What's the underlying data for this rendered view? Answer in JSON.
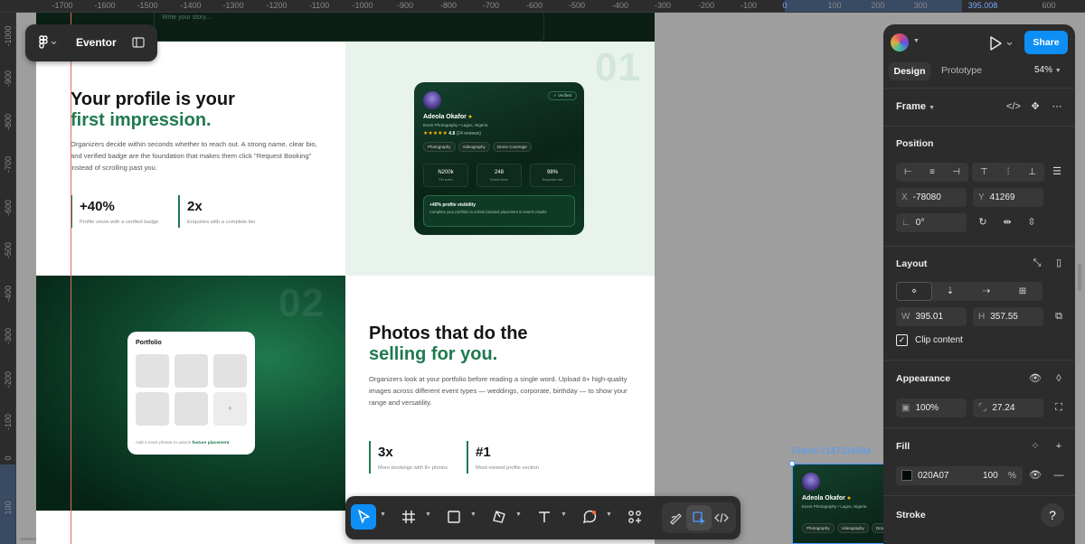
{
  "ruler": {
    "top_ticks": [
      "-1700",
      "-1600",
      "-1500",
      "-1400",
      "-1300",
      "-1200",
      "-1100",
      "-1000",
      "-900",
      "-800",
      "-700",
      "-600",
      "-500",
      "-400",
      "-300",
      "-200",
      "-100",
      "0",
      "100",
      "200",
      "300",
      "395.008",
      "600"
    ],
    "left_ticks": [
      "-1000",
      "-900",
      "-800",
      "-700",
      "-600",
      "-500",
      "-400",
      "-300",
      "-200",
      "-100",
      "0",
      "100"
    ]
  },
  "file": {
    "name": "Eventor"
  },
  "canvas": {
    "story_placeholder": "Write your story...",
    "section1": {
      "title_line1": "Your profile is your",
      "title_line2": "first impression.",
      "body": "Organizers decide within seconds whether to reach out. A strong name, clear bio, and verified badge are the foundation that makes them click \"Request Booking\" instead of scrolling past you.",
      "stats": [
        {
          "value": "+40%",
          "label": "Profile views with a verified badge"
        },
        {
          "value": "2x",
          "label": "Enquiries with a complete bio"
        }
      ],
      "number": "01"
    },
    "profile_card": {
      "verified": "✓ Verified",
      "name": "Adeola Okafor",
      "subtitle": "Event Photography  •  Lagos, Nigeria",
      "stars": "★★★★★",
      "rating": "4.8",
      "reviews": "(24 reviews)",
      "tags": [
        "Photography",
        "Videography",
        "Drone Coverage"
      ],
      "metrics": [
        {
          "value": "N200k",
          "label": "Per event"
        },
        {
          "value": "248",
          "label": "Events done"
        },
        {
          "value": "98%",
          "label": "Response rate"
        }
      ],
      "boost_title": "+40% profile visibility",
      "boost_text": "Complete your portfolio to unlock boosted placement in search results"
    },
    "section2": {
      "number": "02",
      "title_line1": "Photos that do the",
      "title_line2": "selling for you.",
      "body": "Organizers look at your portfolio before reading a single word. Upload 8+ high-quality images across different event types — weddings, corporate, birthday — to show your range and versatility.",
      "stats": [
        {
          "value": "3x",
          "label": "More bookings with 8+ photos"
        },
        {
          "value": "#1",
          "label": "Most-viewed profile section"
        }
      ]
    },
    "portfolio_card": {
      "title": "Portfolio",
      "add": "+",
      "hint": "Add 3 more photos to unlock",
      "hint_link": "feature placement"
    }
  },
  "preview": {
    "label": "Frame 2147224544",
    "name": "Adeola Okafor",
    "subtitle": "Event Photography  •  Lagos, Nigeria",
    "tags": [
      "Photography",
      "Videography",
      "Drone Co"
    ]
  },
  "panel": {
    "share": "Share",
    "tabs": [
      "Design",
      "Prototype"
    ],
    "zoom": "54%",
    "frame": "Frame",
    "position": {
      "title": "Position",
      "x_label": "X",
      "x": "-78080",
      "y_label": "Y",
      "y": "41269",
      "rotation": "0°"
    },
    "layout": {
      "title": "Layout",
      "w_label": "W",
      "w": "395.01",
      "h_label": "H",
      "h": "357.55",
      "clip": "Clip content"
    },
    "appearance": {
      "title": "Appearance",
      "opacity": "100%",
      "radius": "27.24"
    },
    "fill": {
      "title": "Fill",
      "hex": "020A07",
      "opacity": "100",
      "percent": "%"
    },
    "stroke": {
      "title": "Stroke"
    },
    "help": "?"
  },
  "colors": {
    "accent": "#0d8ef5",
    "brand_green": "#1f7a4f",
    "fill": "#020A07"
  }
}
